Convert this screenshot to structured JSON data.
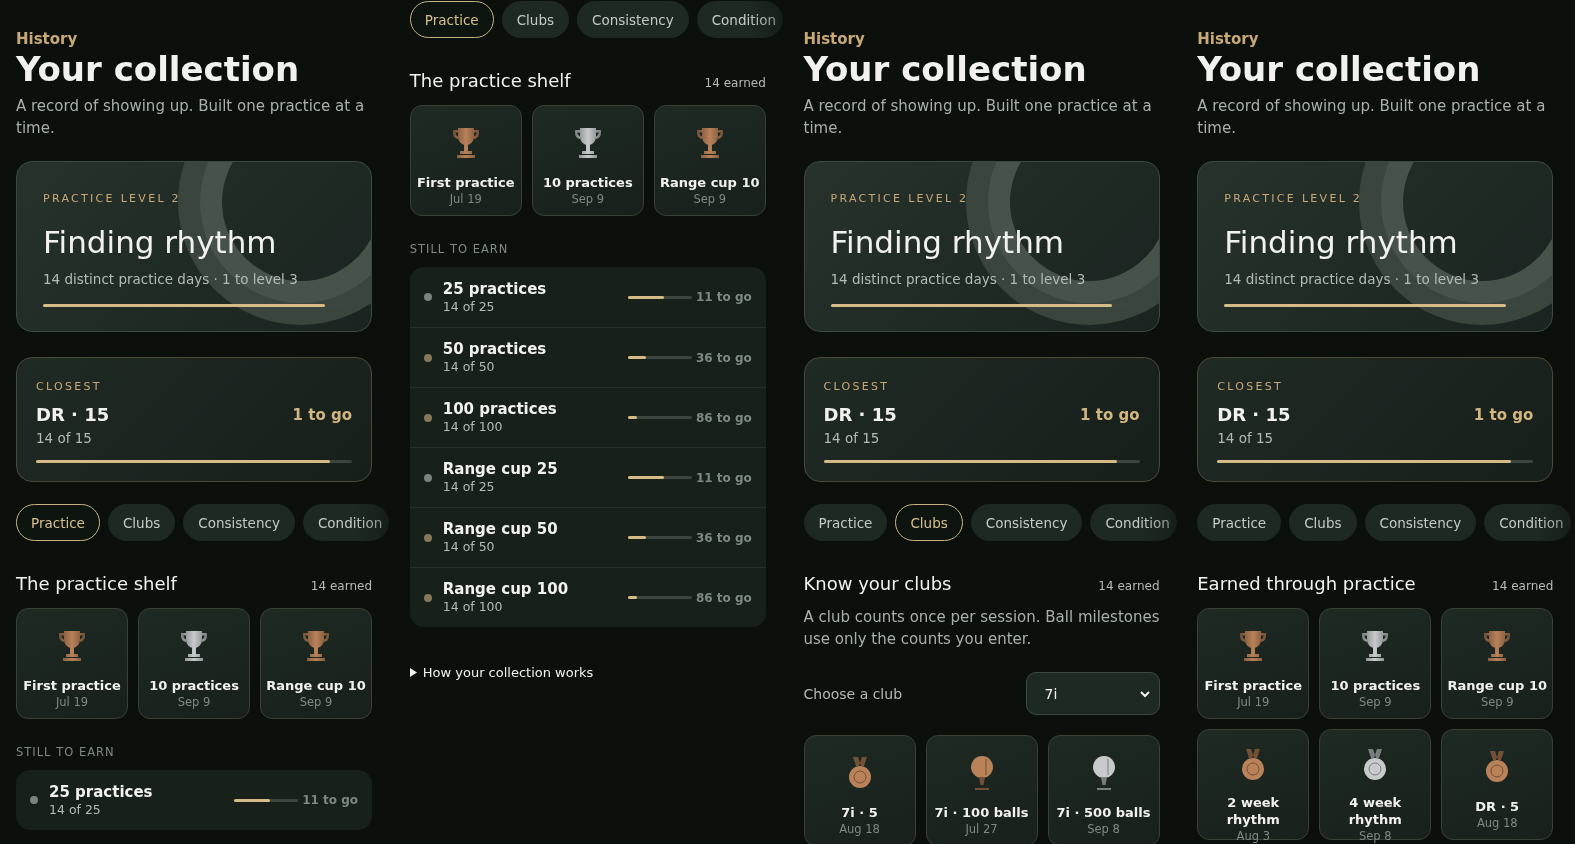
{
  "panels": [
    {
      "header": {
        "eyebrow": "History",
        "title": "Your collection",
        "subtitle": "A record of showing up. Built one practice at a time."
      },
      "level_card": {
        "eyebrow": "PRACTICE LEVEL 2",
        "title": "Finding rhythm",
        "detail": "14 distinct practice days · 1 to level 3",
        "level": 0.93
      },
      "closest": {
        "eyebrow": "CLOSEST",
        "title": "DR · 15",
        "detail": "14 of 15",
        "reading": "1 to go",
        "level": 0.93
      },
      "tabs": [
        {
          "label": "Practice",
          "selected": true
        },
        {
          "label": "Clubs",
          "selected": false
        },
        {
          "label": "Consistency",
          "selected": false
        },
        {
          "label": "Condition",
          "selected": false
        }
      ],
      "section": {
        "title": "The practice shelf",
        "count": "14 earned",
        "badges": [
          {
            "kind": "trophy",
            "color": "#b98259",
            "title": "First practice",
            "date": "Jul 19"
          },
          {
            "kind": "trophy",
            "color": "#c7cbcb",
            "title": "10 practices",
            "date": "Sep 9"
          },
          {
            "kind": "trophy",
            "color": "#b98259",
            "title": "Range cup 10",
            "date": "Sep 9"
          }
        ]
      },
      "still_to_earn": {
        "label": "STILL TO EARN",
        "items": [
          {
            "title": "25 practices",
            "detail": "14 of 25",
            "level": 0.56,
            "reading": "11 to go",
            "color": "#7c827e"
          }
        ]
      }
    },
    {
      "tabs": [
        {
          "label": "Practice",
          "selected": true
        },
        {
          "label": "Clubs",
          "selected": false
        },
        {
          "label": "Consistency",
          "selected": false
        },
        {
          "label": "Condition",
          "selected": false
        }
      ],
      "section": {
        "title": "The practice shelf",
        "count": "14 earned",
        "badges": [
          {
            "kind": "trophy",
            "color": "#b98259",
            "title": "First practice",
            "date": "Jul 19"
          },
          {
            "kind": "trophy",
            "color": "#c7cbcb",
            "title": "10 practices",
            "date": "Sep 9"
          },
          {
            "kind": "trophy",
            "color": "#b98259",
            "title": "Range cup 10",
            "date": "Sep 9"
          }
        ]
      },
      "still_to_earn": {
        "label": "STILL TO EARN",
        "items": [
          {
            "title": "25 practices",
            "detail": "14 of 25",
            "level": 0.56,
            "reading": "11 to go",
            "color": "#7c827e"
          },
          {
            "title": "50 practices",
            "detail": "14 of 50",
            "level": 0.28,
            "reading": "36 to go",
            "color": "#85785a"
          },
          {
            "title": "100 practices",
            "detail": "14 of 100",
            "level": 0.14,
            "reading": "86 to go",
            "color": "#85785a"
          },
          {
            "title": "Range cup 25",
            "detail": "14 of 25",
            "level": 0.56,
            "reading": "11 to go",
            "color": "#7c827e"
          },
          {
            "title": "Range cup 50",
            "detail": "14 of 50",
            "level": 0.28,
            "reading": "36 to go",
            "color": "#85785a"
          },
          {
            "title": "Range cup 100",
            "detail": "14 of 100",
            "level": 0.14,
            "reading": "86 to go",
            "color": "#85785a"
          }
        ]
      },
      "details": {
        "summary": "How your collection works"
      }
    },
    {
      "header": {
        "eyebrow": "History",
        "title": "Your collection",
        "subtitle": "A record of showing up. Built one practice at a time."
      },
      "level_card": {
        "eyebrow": "PRACTICE LEVEL 2",
        "title": "Finding rhythm",
        "detail": "14 distinct practice days · 1 to level 3",
        "level": 0.93
      },
      "closest": {
        "eyebrow": "CLOSEST",
        "title": "DR · 15",
        "detail": "14 of 15",
        "reading": "1 to go",
        "level": 0.93
      },
      "tabs": [
        {
          "label": "Practice",
          "selected": false
        },
        {
          "label": "Clubs",
          "selected": true
        },
        {
          "label": "Consistency",
          "selected": false
        },
        {
          "label": "Condition",
          "selected": false
        }
      ],
      "section": {
        "title": "Know your clubs",
        "count": "14 earned",
        "note": "A club counts once per session. Ball milestones use only the counts you enter.",
        "picker": {
          "label": "Choose a club",
          "value": "7i"
        },
        "badges": [
          {
            "kind": "medal",
            "color": "#b98259",
            "title": "7i · 5",
            "date": "Aug 18"
          },
          {
            "kind": "ball",
            "color": "#b98259",
            "title": "7i · 100 balls",
            "date": "Jul 27"
          },
          {
            "kind": "ball",
            "color": "#c7cbcb",
            "title": "7i · 500 balls",
            "date": "Sep 8"
          }
        ]
      }
    },
    {
      "header": {
        "eyebrow": "History",
        "title": "Your collection",
        "subtitle": "A record of showing up. Built one practice at a time."
      },
      "level_card": {
        "eyebrow": "PRACTICE LEVEL 2",
        "title": "Finding rhythm",
        "detail": "14 distinct practice days · 1 to level 3",
        "level": 0.93
      },
      "closest": {
        "eyebrow": "CLOSEST",
        "title": "DR · 15",
        "detail": "14 of 15",
        "reading": "1 to go",
        "level": 0.93
      },
      "tabs": [
        {
          "label": "Practice",
          "selected": false
        },
        {
          "label": "Clubs",
          "selected": false
        },
        {
          "label": "Consistency",
          "selected": false
        },
        {
          "label": "Condition",
          "selected": false
        }
      ],
      "section": {
        "title": "Earned through practice",
        "count": "14 earned",
        "badges": [
          {
            "kind": "trophy",
            "color": "#b98259",
            "title": "First practice",
            "date": "Jul 19"
          },
          {
            "kind": "trophy",
            "color": "#c7cbcb",
            "title": "10 practices",
            "date": "Sep 9"
          },
          {
            "kind": "trophy",
            "color": "#b98259",
            "title": "Range cup 10",
            "date": "Sep 9"
          },
          {
            "kind": "medal",
            "color": "#b98259",
            "title": "2 week rhythm",
            "date": "Aug 3"
          },
          {
            "kind": "medal",
            "color": "#c7cbcb",
            "title": "4 week rhythm",
            "date": "Sep 8"
          },
          {
            "kind": "medal",
            "color": "#b98259",
            "title": "DR · 5",
            "date": "Aug 18"
          }
        ]
      }
    }
  ]
}
